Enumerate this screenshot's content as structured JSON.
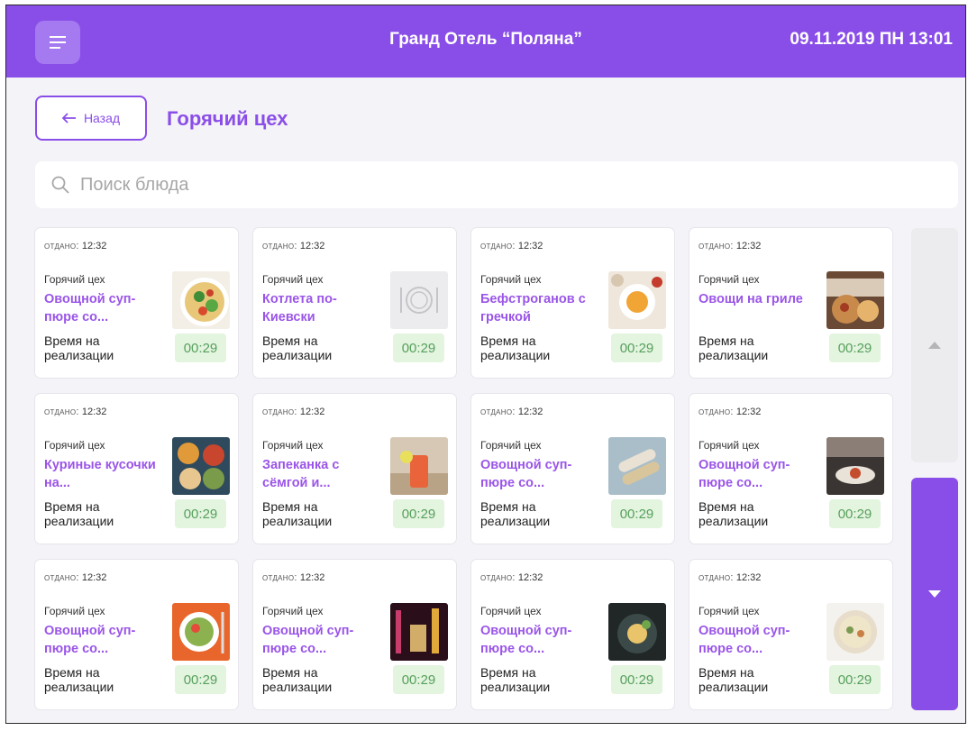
{
  "header": {
    "hotel": "Гранд Отель “Поляна”",
    "datetime": "09.11.2019 ПН 13:01"
  },
  "nav": {
    "back_label": "Назад",
    "title": "Горячий цех"
  },
  "search": {
    "placeholder": "Поиск блюда"
  },
  "colors": {
    "accent": "#8a4ee8",
    "timer_bg": "#e3f4df",
    "timer_text": "#57a05c"
  },
  "cards": [
    {
      "given_label": "отдано:",
      "given_time": "12:32",
      "dept": "Горячий цех",
      "dish": "Овощной суп-пюре со...",
      "realize": "Время на реализации",
      "timer": "00:29",
      "image": "salad-photo"
    },
    {
      "given_label": "отдано:",
      "given_time": "12:32",
      "dept": "Горячий цех",
      "dish": "Котлета по-Киевски",
      "realize": "Время на реализации",
      "timer": "00:29",
      "image": "plate-placeholder-icon"
    },
    {
      "given_label": "отдано:",
      "given_time": "12:32",
      "dept": "Горячий цех",
      "dish": "Бефстроганов с гречкой",
      "realize": "Время на реализации",
      "timer": "00:29",
      "image": "dish-photo"
    },
    {
      "given_label": "отдано:",
      "given_time": "12:32",
      "dept": "Горячий цех",
      "dish": "Овощи на гриле",
      "realize": "Время на реализации",
      "timer": "00:29",
      "image": "grill-photo"
    },
    {
      "given_label": "отдано:",
      "given_time": "12:32",
      "dept": "Горячий цех",
      "dish": "Куриные кусочки на...",
      "realize": "Время на реализации",
      "timer": "00:29",
      "image": "platter-photo"
    },
    {
      "given_label": "отдано:",
      "given_time": "12:32",
      "dept": "Горячий цех",
      "dish": "Запеканка с сёмгой и...",
      "realize": "Время на реализации",
      "timer": "00:29",
      "image": "cocktail-photo"
    },
    {
      "given_label": "отдано:",
      "given_time": "12:32",
      "dept": "Горячий цех",
      "dish": "Овощной суп-пюре со...",
      "realize": "Время на реализации",
      "timer": "00:29",
      "image": "rolls-photo"
    },
    {
      "given_label": "отдано:",
      "given_time": "12:32",
      "dept": "Горячий цех",
      "dish": "Овощной суп-пюре со...",
      "realize": "Время на реализации",
      "timer": "00:29",
      "image": "restaurant-photo"
    },
    {
      "given_label": "отдано:",
      "given_time": "12:32",
      "dept": "Горячий цех",
      "dish": "Овощной суп-пюре со...",
      "realize": "Время на реализации",
      "timer": "00:29",
      "image": "bowl-orange-photo"
    },
    {
      "given_label": "отдано:",
      "given_time": "12:32",
      "dept": "Горячий цех",
      "dish": "Овощной суп-пюре со...",
      "realize": "Время на реализации",
      "timer": "00:29",
      "image": "drinks-photo"
    },
    {
      "given_label": "отдано:",
      "given_time": "12:32",
      "dept": "Горячий цех",
      "dish": "Овощной суп-пюре со...",
      "realize": "Время на реализации",
      "timer": "00:29",
      "image": "dark-plate-photo"
    },
    {
      "given_label": "отдано:",
      "given_time": "12:32",
      "dept": "Горячий цех",
      "dish": "Овощной суп-пюре со...",
      "realize": "Время на реализации",
      "timer": "00:29",
      "image": "soup-bowl-photo"
    }
  ]
}
